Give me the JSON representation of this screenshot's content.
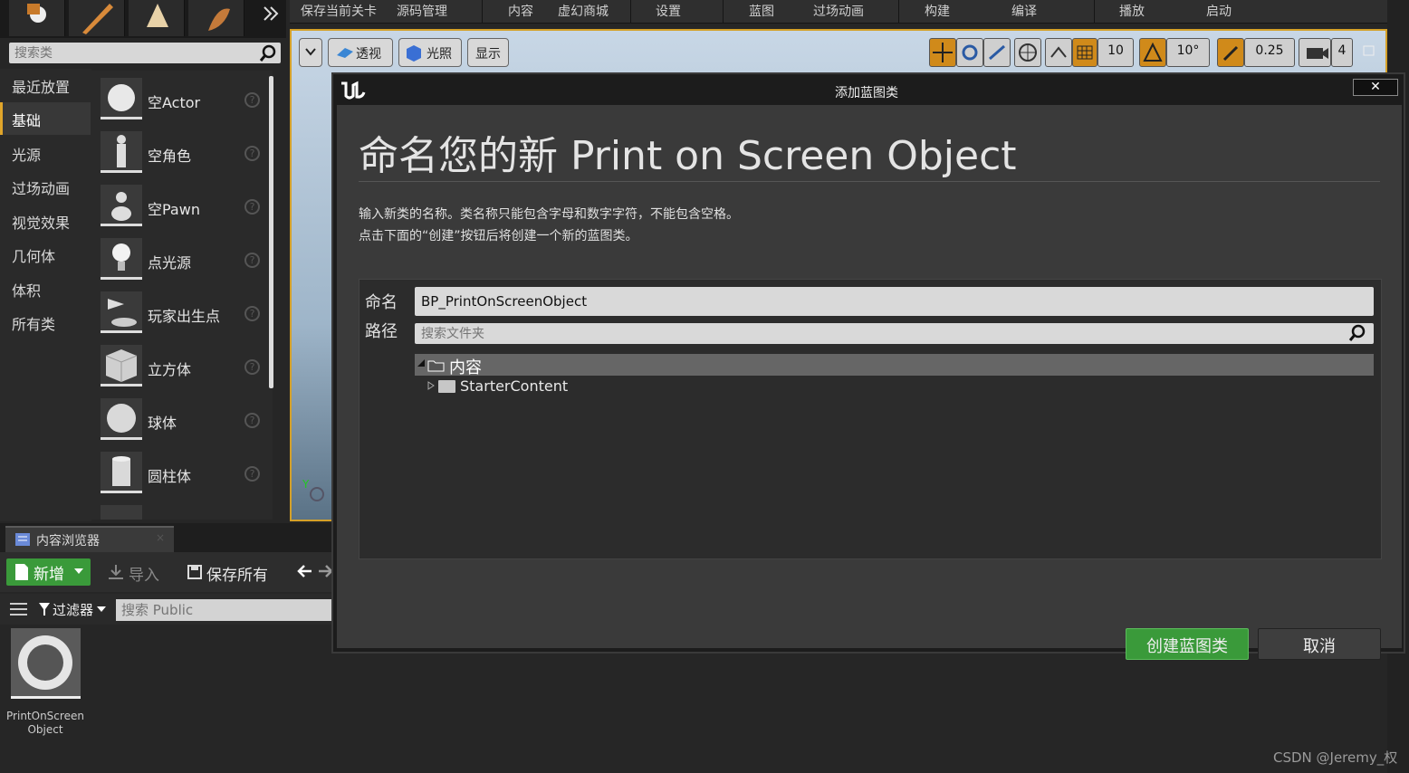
{
  "top_menu": {
    "items": [
      "保存当前关卡",
      "源码管理",
      "内容",
      "虚幻商城",
      "设置",
      "蓝图",
      "过场动画",
      "构建",
      "编译",
      "播放",
      "启动"
    ]
  },
  "place_panel": {
    "search_placeholder": "搜索类",
    "categories": [
      "最近放置",
      "基础",
      "光源",
      "过场动画",
      "视觉效果",
      "几何体",
      "体积",
      "所有类"
    ],
    "active_category": "基础",
    "items": [
      "空Actor",
      "空角色",
      "空Pawn",
      "点光源",
      "玩家出生点",
      "立方体",
      "球体",
      "圆柱体"
    ]
  },
  "viewport": {
    "perspective_label": "透视",
    "lighting_label": "光照",
    "show_label": "显示",
    "grid_snap": "10",
    "rotation_snap": "10°",
    "scale_snap": "0.25",
    "camera_speed": "4",
    "axis_label": "Y"
  },
  "content_browser": {
    "tab_label": "内容浏览器",
    "new_label": "新增",
    "import_label": "导入",
    "save_all_label": "保存所有",
    "filter_label": "过滤器",
    "search_placeholder": "搜索 Public",
    "asset_name": "PrintOnScreen Object"
  },
  "dialog": {
    "title": "添加蓝图类",
    "heading": "命名您的新 Print on Screen Object",
    "desc_line1": "输入新类的名称。类名称只能包含字母和数字字符，不能包含空格。",
    "desc_line2": "点击下面的“创建”按钮后将创建一个新的蓝图类。",
    "name_label": "命名",
    "path_label": "路径",
    "name_value": "BP_PrintOnScreenObject",
    "folder_search_placeholder": "搜索文件夹",
    "tree_root": "内容",
    "tree_child": "StarterContent",
    "create_label": "创建蓝图类",
    "cancel_label": "取消",
    "close_symbol": "✕"
  },
  "watermark": "CSDN @Jeremy_权",
  "colors": {
    "accent_orange": "#d4a028",
    "create_green": "#3a9a3a",
    "dialog_bg": "#3a3a3a"
  }
}
